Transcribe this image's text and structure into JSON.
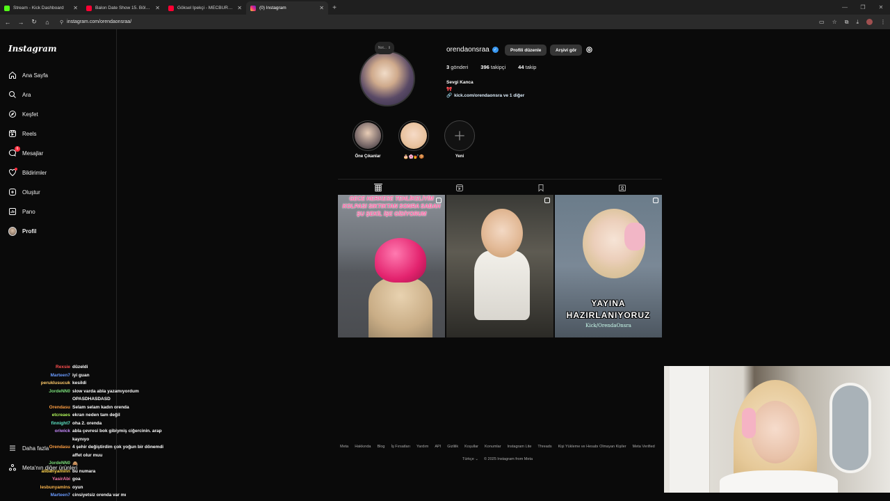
{
  "browser": {
    "tabs": [
      {
        "label": "Stream - Kick Dashboard",
        "color": "#53fc18",
        "active": false
      },
      {
        "label": "Balon Date Show 15. Bölüm - Y",
        "color": "#ff0033",
        "active": false
      },
      {
        "label": "Göksel İpekçi - MECBURUM (C",
        "color": "#ff0033",
        "active": false
      },
      {
        "label": "(0) Instagram",
        "color": "#e1306c",
        "active": true
      }
    ],
    "url": "instagram.com/orendaonsraa/"
  },
  "sidebar": {
    "logo": "Instagram",
    "items": [
      {
        "label": "Ana Sayfa",
        "icon": "home-icon"
      },
      {
        "label": "Ara",
        "icon": "search-icon"
      },
      {
        "label": "Keşfet",
        "icon": "compass-icon"
      },
      {
        "label": "Reels",
        "icon": "reels-icon"
      },
      {
        "label": "Mesajlar",
        "icon": "messenger-icon",
        "badge": "6"
      },
      {
        "label": "Bildirimler",
        "icon": "heart-icon"
      },
      {
        "label": "Oluştur",
        "icon": "plus-square-icon"
      },
      {
        "label": "Pano",
        "icon": "chart-icon"
      },
      {
        "label": "Profil",
        "icon": "avatar-icon"
      }
    ],
    "more": "Daha fazla",
    "meta": "Meta'nın diğer ürünleri"
  },
  "profile": {
    "note": "Not...",
    "username": "orendaonsraa",
    "edit_button": "Profili düzenle",
    "archive_button": "Arşivi gör",
    "posts_count": "3",
    "posts_label": "gönderi",
    "followers_count": "396",
    "followers_label": "takipçi",
    "following_count": "44",
    "following_label": "takip",
    "full_name": "Sevgi Kanca",
    "bio_emoji": "🎀",
    "link": "kick.com/orendaonsra ve 1 diğer"
  },
  "highlights": [
    {
      "label": "Öne Çıkanlar"
    },
    {
      "label": "🎂🌸💅🍪"
    },
    {
      "label": "Yeni"
    }
  ],
  "posts": [
    {
      "caption": "GECE HERKESE TEHLİKELİYİM KOLPASI SIKTIKTAN SONRA SABAH ŞU ŞEKİL İŞE GİDİYORUM"
    },
    {
      "caption": ""
    },
    {
      "caption": "YAYINA HAZIRLANIYORUZ",
      "watermark": "Kick/OrendaOnsra"
    }
  ],
  "footer": {
    "links": [
      "Meta",
      "Hakkında",
      "Blog",
      "İş Fırsatları",
      "Yardım",
      "API",
      "Gizlilik",
      "Koşullar",
      "Konumlar",
      "Instagram Lite",
      "Threads",
      "Kişi Yükleme ve Hesabı Olmayan Kişiler",
      "Meta Verified"
    ],
    "language": "Türkçe",
    "copyright": "© 2025 Instagram from Meta"
  },
  "chat": [
    {
      "user": "Rexsie",
      "color": "#ff4f4f",
      "msg": "düzeldi"
    },
    {
      "user": "Marteen7",
      "color": "#6a9bff",
      "msg": "iyi guan"
    },
    {
      "user": "peruklusucuk",
      "color": "#ffcb6b",
      "msg": "kesildi"
    },
    {
      "user": "JordeNN0",
      "color": "#7be07b",
      "msg": "slow varda abla yazamıyordum",
      "cont": "OPASDHASDASD"
    },
    {
      "user": "Orendasu",
      "color": "#ff9f43",
      "msg": "Selam selam kadın orenda"
    },
    {
      "user": "etcreaes",
      "color": "#aef359",
      "msg": "ekran neden tam değil"
    },
    {
      "user": "finnight7",
      "color": "#5ee6c8",
      "msg": "oha 2. orenda"
    },
    {
      "user": "oriwick",
      "color": "#c88cff",
      "msg": "abla çevresi bok gibiymiş ciğercinin. arap",
      "cont": "kaynıyo"
    },
    {
      "user": "Orendasu",
      "color": "#ff9f43",
      "msg": "4 şehir değiştirdim çok yoğun bir dönemdi",
      "cont": "affet olur muu"
    },
    {
      "user": "JordeNN0",
      "color": "#7be07b",
      "msg": "🙈"
    },
    {
      "user": "alibanyaminn",
      "color": "#ffd54f",
      "msg": "bu numara"
    },
    {
      "user": "YasirAbi",
      "color": "#ff7ab0",
      "msg": "goa"
    },
    {
      "user": "lesbunyamins",
      "color": "#ffb74d",
      "msg": "oyun"
    },
    {
      "user": "Marteen7",
      "color": "#6a9bff",
      "msg": "cinsiyetsiz orenda var mı"
    }
  ]
}
